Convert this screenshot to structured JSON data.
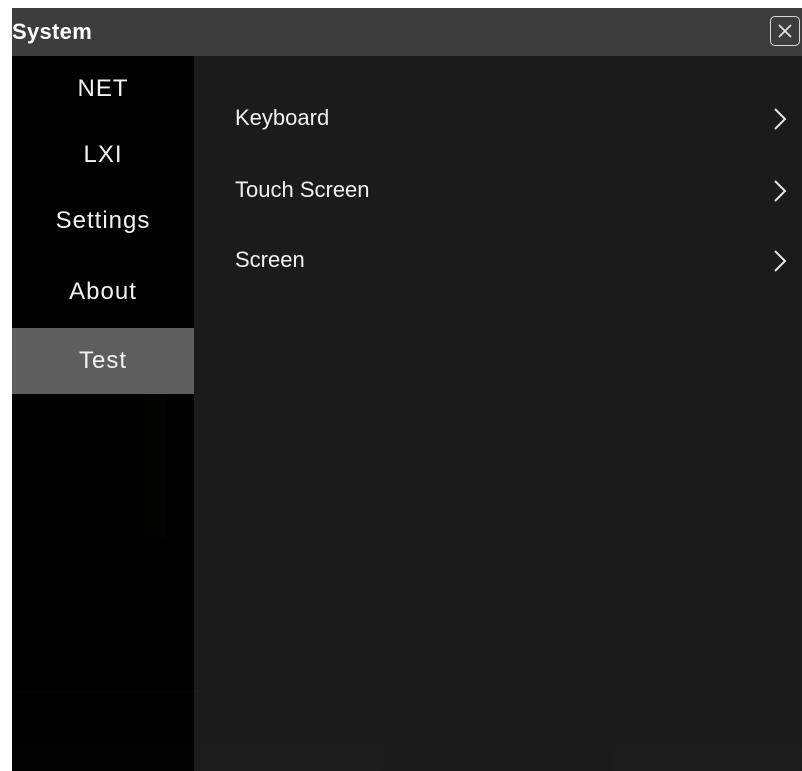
{
  "window": {
    "title": "System",
    "close_icon": "close-icon"
  },
  "sidebar": {
    "items": [
      {
        "label": "NET",
        "active": false
      },
      {
        "label": "LXI",
        "active": false
      },
      {
        "label": "Settings",
        "active": false
      },
      {
        "label": "About",
        "active": false
      },
      {
        "label": "Test",
        "active": true
      }
    ]
  },
  "content": {
    "items": [
      {
        "label": "Keyboard",
        "icon": "chevron-right-icon"
      },
      {
        "label": "Touch Screen",
        "icon": "chevron-right-icon"
      },
      {
        "label": "Screen",
        "icon": "chevron-right-icon"
      }
    ]
  },
  "colors": {
    "titlebar": "#3d3d3d",
    "active_item": "#5e5e5e",
    "text": "#f0f0f0"
  }
}
